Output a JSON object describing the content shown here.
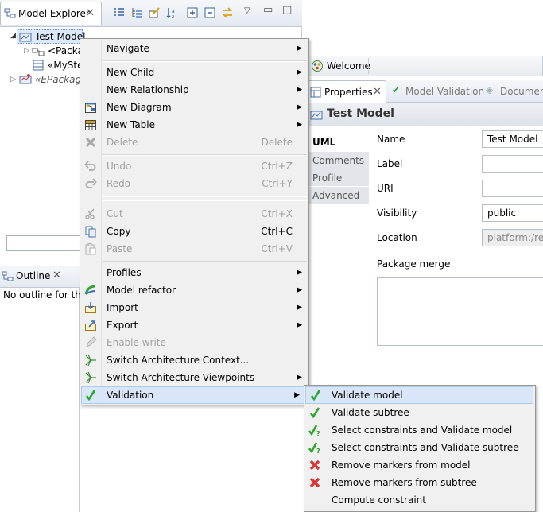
{
  "explorer": {
    "title": "Model Explorer",
    "tree": {
      "root": "Test Model",
      "child1": "<Packa",
      "child2": "«MySte",
      "epackage": "«EPackage"
    },
    "filter_value": ""
  },
  "outline": {
    "title": "Outline",
    "empty_text": "No outline for this"
  },
  "welcome": {
    "title": "Welcome"
  },
  "properties": {
    "tabs": {
      "properties": "Properties",
      "validation": "Model Validation",
      "documentation": "Documen"
    },
    "header": "Test Model",
    "side_tabs": [
      "UML",
      "Comments",
      "Profile",
      "Advanced"
    ],
    "fields": {
      "name_label": "Name",
      "name_value": "Test Model",
      "label_label": "Label",
      "label_value": "",
      "uri_label": "URI",
      "uri_value": "",
      "visibility_label": "Visibility",
      "visibility_value": "public",
      "location_label": "Location",
      "location_value": "platform:/reso",
      "package_merge_label": "Package merge"
    }
  },
  "context_menu": {
    "navigate": "Navigate",
    "new_child": "New Child",
    "new_relationship": "New Relationship",
    "new_diagram": "New Diagram",
    "new_table": "New Table",
    "delete": "Delete",
    "delete_shortcut": "Delete",
    "undo": "Undo",
    "undo_shortcut": "Ctrl+Z",
    "redo": "Redo",
    "redo_shortcut": "Ctrl+Y",
    "cut": "Cut",
    "cut_shortcut": "Ctrl+X",
    "copy": "Copy",
    "copy_shortcut": "Ctrl+C",
    "paste": "Paste",
    "paste_shortcut": "Ctrl+V",
    "profiles": "Profiles",
    "model_refactor": "Model refactor",
    "import": "Import",
    "export": "Export",
    "enable_write": "Enable write",
    "switch_context": "Switch Architecture Context...",
    "switch_viewpoints": "Switch Architecture Viewpoints",
    "validation": "Validation"
  },
  "validation_submenu": {
    "validate_model": "Validate model",
    "validate_subtree": "Validate subtree",
    "select_validate_model": "Select constraints and Validate model",
    "select_validate_subtree": "Select constraints and Validate subtree",
    "remove_markers_model": "Remove markers from model",
    "remove_markers_subtree": "Remove markers from subtree",
    "compute_constraint": "Compute constraint"
  },
  "colors": {
    "menu_bg": "#f0f0f0",
    "highlight": "#d8e6f7",
    "check_green": "#2ea52e",
    "remove_red": "#d93636"
  }
}
